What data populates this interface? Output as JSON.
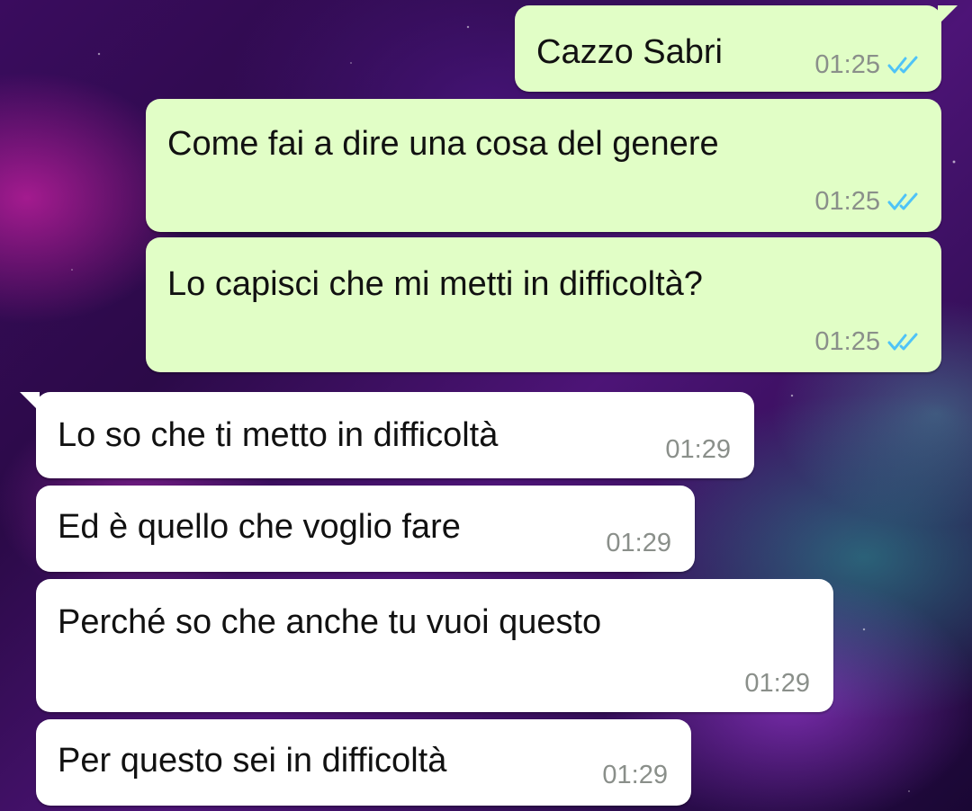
{
  "chat": {
    "messages": [
      {
        "direction": "outgoing",
        "text": "Cazzo Sabri",
        "time": "01:25",
        "status": "read-double-check-icon"
      },
      {
        "direction": "outgoing",
        "text": "Come fai a dire una cosa del genere",
        "time": "01:25",
        "status": "read-double-check-icon"
      },
      {
        "direction": "outgoing",
        "text": "Lo capisci che mi metti in difficoltà?",
        "time": "01:25",
        "status": "read-double-check-icon"
      },
      {
        "direction": "incoming",
        "text": "Lo so che ti metto in difficoltà",
        "time": "01:29"
      },
      {
        "direction": "incoming",
        "text": "Ed è quello che voglio fare",
        "time": "01:29"
      },
      {
        "direction": "incoming",
        "text": "Perché so che anche tu vuoi questo",
        "time": "01:29"
      },
      {
        "direction": "incoming",
        "text": "Per questo sei in difficoltà",
        "time": "01:29"
      }
    ]
  },
  "colors": {
    "outgoing_bubble": "#e1fec6",
    "incoming_bubble": "#ffffff",
    "read_ticks": "#4fc3f7",
    "timestamp": "#8a8f8a"
  }
}
